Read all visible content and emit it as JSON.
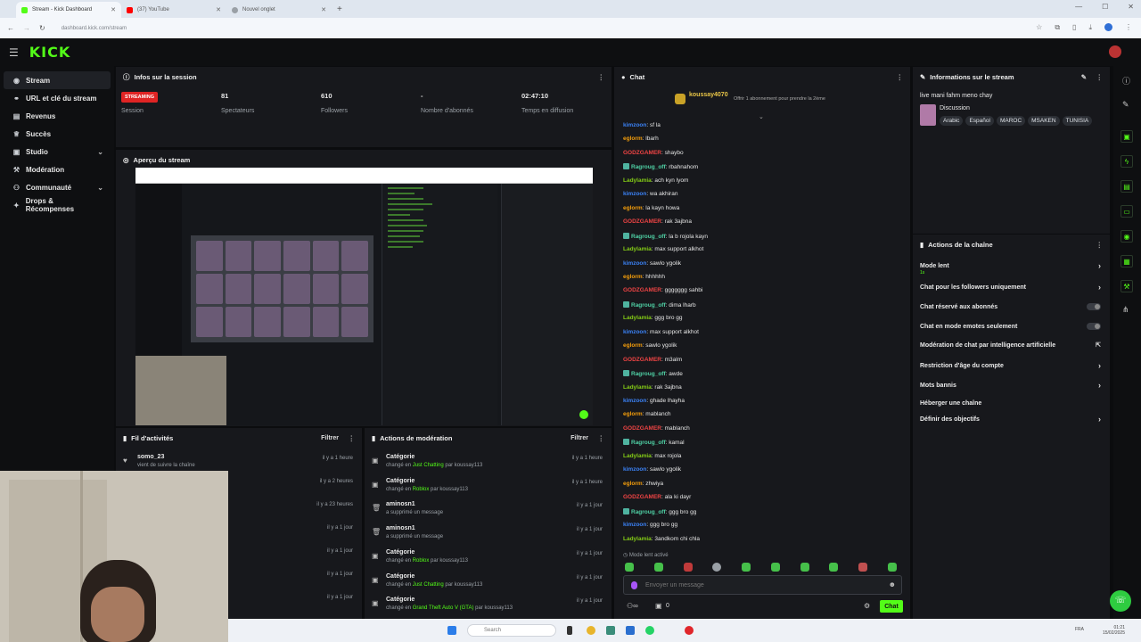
{
  "browser": {
    "tabs": [
      {
        "label": "Stream - Kick Dashboard",
        "color": "#53fc18"
      },
      {
        "label": "(37) YouTube",
        "color": "#ff0000"
      },
      {
        "label": "Nouvel onglet",
        "color": "#9aa0a6"
      }
    ],
    "url": "dashboard.kick.com/stream"
  },
  "app": {
    "logo": "KICK"
  },
  "sidebar": {
    "items": [
      {
        "label": "Stream",
        "icon": "broadcast-icon"
      },
      {
        "label": "URL et clé du stream",
        "icon": "link-icon"
      },
      {
        "label": "Revenus",
        "icon": "money-icon"
      },
      {
        "label": "Succès",
        "icon": "trophy-icon"
      },
      {
        "label": "Studio",
        "icon": "studio-icon"
      },
      {
        "label": "Modération",
        "icon": "gavel-icon"
      },
      {
        "label": "Communauté",
        "icon": "community-icon"
      },
      {
        "label": "Drops & Récompenses",
        "icon": "gift-icon"
      }
    ]
  },
  "session": {
    "title": "Infos sur la session",
    "badge": "STREAMING",
    "session_label": "Session",
    "viewers": "81",
    "viewers_label": "Spectateurs",
    "followers": "610",
    "followers_label": "Followers",
    "subs": "-",
    "subs_label": "Nombre d'abonnés",
    "time": "02:47:10",
    "time_label": "Temps en diffusion"
  },
  "preview": {
    "title": "Aperçu du stream"
  },
  "activity": {
    "title": "Fil d'activités",
    "filter": "Filtrer",
    "rows": [
      {
        "name": "somo_23",
        "desc": "vient de suivre la chaîne",
        "time": "il y a 1 heure"
      },
      {
        "name": "",
        "desc": "",
        "time": "il y a 2 heures"
      },
      {
        "name": "",
        "desc": "",
        "time": "il y a 23 heures"
      },
      {
        "name": "",
        "desc": "",
        "time": "il y a 1 jour"
      },
      {
        "name": "",
        "desc": "",
        "time": "il y a 1 jour"
      },
      {
        "name": "",
        "desc": "",
        "time": "il y a 1 jour"
      },
      {
        "name": "",
        "desc": "",
        "time": "il y a 1 jour"
      }
    ]
  },
  "moderation": {
    "title": "Actions de modération",
    "filter": "Filtrer",
    "rows": [
      {
        "title": "Catégorie",
        "pre": "changé en ",
        "hl": "Just Chatting",
        "post": " par koussay113",
        "time": "il y a 1 heure"
      },
      {
        "title": "Catégorie",
        "pre": "changé en ",
        "hl": "Roblox",
        "post": " par koussay113",
        "time": "il y a 1 heure"
      },
      {
        "title": "aminosn1",
        "pre": "a supprimé un message",
        "hl": "",
        "post": "",
        "time": "il y a 1 jour"
      },
      {
        "title": "aminosn1",
        "pre": "a supprimé un message",
        "hl": "",
        "post": "",
        "time": "il y a 1 jour"
      },
      {
        "title": "Catégorie",
        "pre": "changé en ",
        "hl": "Roblox",
        "post": " par koussay113",
        "time": "il y a 1 jour"
      },
      {
        "title": "Catégorie",
        "pre": "changé en ",
        "hl": "Just Chatting",
        "post": " par koussay113",
        "time": "il y a 1 jour"
      },
      {
        "title": "Catégorie",
        "pre": "changé en ",
        "hl": "Grand Theft Auto V (GTA)",
        "post": " par koussay113",
        "time": "il y a 1 jour"
      }
    ]
  },
  "chat": {
    "title": "Chat",
    "gift_user": "koussay4070",
    "gift_text": "Offrir 1 abonnement pour prendre la 2ème",
    "messages": [
      {
        "user": "kimzoon",
        "text": "sf la",
        "color": "#3b82f6",
        "badge": false
      },
      {
        "user": "eglorm",
        "text": "lbarh",
        "color": "#f59e0b",
        "badge": false
      },
      {
        "user": "GODZGAMER",
        "text": "shaybo",
        "color": "#ef4444",
        "badge": false
      },
      {
        "user": "Ragroug_off",
        "text": "rbahnahom",
        "color": "#4fd1a5",
        "badge": true
      },
      {
        "user": "Ladylamia",
        "text": "ach kyn lyom",
        "color": "#84cc16",
        "badge": false
      },
      {
        "user": "kimzoon",
        "text": "wa akhiran",
        "color": "#3b82f6",
        "badge": false
      },
      {
        "user": "eglorm",
        "text": "la kayn howa",
        "color": "#f59e0b",
        "badge": false
      },
      {
        "user": "GODZGAMER",
        "text": "rak 3ajbna",
        "color": "#ef4444",
        "badge": false
      },
      {
        "user": "Ragroug_off",
        "text": "la b rojola kayn",
        "color": "#4fd1a5",
        "badge": true
      },
      {
        "user": "Ladylamia",
        "text": "max support alkhot",
        "color": "#84cc16",
        "badge": false
      },
      {
        "user": "kimzoon",
        "text": "sawlo ygolik",
        "color": "#3b82f6",
        "badge": false
      },
      {
        "user": "eglorm",
        "text": "hhhhhh",
        "color": "#f59e0b",
        "badge": false
      },
      {
        "user": "GODZGAMER",
        "text": "ggggggg sahbi",
        "color": "#ef4444",
        "badge": false
      },
      {
        "user": "Ragroug_off",
        "text": "dima lharb",
        "color": "#4fd1a5",
        "badge": true
      },
      {
        "user": "Ladylamia",
        "text": "ggg bro gg",
        "color": "#84cc16",
        "badge": false
      },
      {
        "user": "kimzoon",
        "text": "max support alkhot",
        "color": "#3b82f6",
        "badge": false
      },
      {
        "user": "eglorm",
        "text": "sawlo ygolik",
        "color": "#f59e0b",
        "badge": false
      },
      {
        "user": "GODZGAMER",
        "text": "m3alm",
        "color": "#ef4444",
        "badge": false
      },
      {
        "user": "Ragroug_off",
        "text": "awde",
        "color": "#4fd1a5",
        "badge": true
      },
      {
        "user": "Ladylamia",
        "text": "rak 3ajbna",
        "color": "#84cc16",
        "badge": false
      },
      {
        "user": "kimzoon",
        "text": "ghade lhayha",
        "color": "#3b82f6",
        "badge": false
      },
      {
        "user": "eglorm",
        "text": "mablanch",
        "color": "#f59e0b",
        "badge": false
      },
      {
        "user": "GODZGAMER",
        "text": "mablanch",
        "color": "#ef4444",
        "badge": false
      },
      {
        "user": "Ragroug_off",
        "text": "kamal",
        "color": "#4fd1a5",
        "badge": true
      },
      {
        "user": "Ladylamia",
        "text": "max rojola",
        "color": "#84cc16",
        "badge": false
      },
      {
        "user": "kimzoon",
        "text": "sawlo ygolik",
        "color": "#3b82f6",
        "badge": false
      },
      {
        "user": "eglorm",
        "text": "zhwiya",
        "color": "#f59e0b",
        "badge": false
      },
      {
        "user": "GODZGAMER",
        "text": "ala ki dayr",
        "color": "#ef4444",
        "badge": false
      },
      {
        "user": "Ragroug_off",
        "text": "ggg bro gg",
        "color": "#4fd1a5",
        "badge": true
      },
      {
        "user": "kimzoon",
        "text": "ggg bro gg",
        "color": "#3b82f6",
        "badge": false
      },
      {
        "user": "Ladylamia",
        "text": "3andkom chi chla",
        "color": "#84cc16",
        "badge": false
      }
    ],
    "slow_mode": "Mode lent activé",
    "placeholder": "Envoyer un message",
    "count": "0",
    "send": "Chat"
  },
  "stream_info": {
    "title": "Informations sur le stream",
    "stream_title": "live mani fahm meno chay",
    "category": "Discussion",
    "tags": [
      "Arabic",
      "Español",
      "MAROC",
      "MSAKEN",
      "TUNISIA"
    ]
  },
  "channel_actions": {
    "title": "Actions de la chaîne",
    "items": [
      {
        "label": "Mode lent",
        "sub": "1s",
        "control": "chevron"
      },
      {
        "label": "Chat pour les followers uniquement",
        "sub": "",
        "control": "chevron"
      },
      {
        "label": "Chat réservé aux abonnés",
        "sub": "",
        "control": "toggle"
      },
      {
        "label": "Chat en mode emotes seulement",
        "sub": "",
        "control": "toggle"
      },
      {
        "label": "Modération de chat par intelligence artificielle",
        "sub": "",
        "control": "external"
      },
      {
        "label": "Restriction d'âge du compte",
        "sub": "",
        "control": "chevron"
      },
      {
        "label": "Mots bannis",
        "sub": "",
        "control": "chevron"
      },
      {
        "label": "Héberger une chaîne",
        "sub": "",
        "control": "none"
      },
      {
        "label": "Définir des objectifs",
        "sub": "",
        "control": "chevron"
      }
    ]
  },
  "taskbar": {
    "search": "Search",
    "clock_time": "01:21",
    "clock_date": "15/02/2025",
    "lang": "FRA"
  },
  "colors": {
    "accent": "#53fc18",
    "live": "#e02424"
  }
}
